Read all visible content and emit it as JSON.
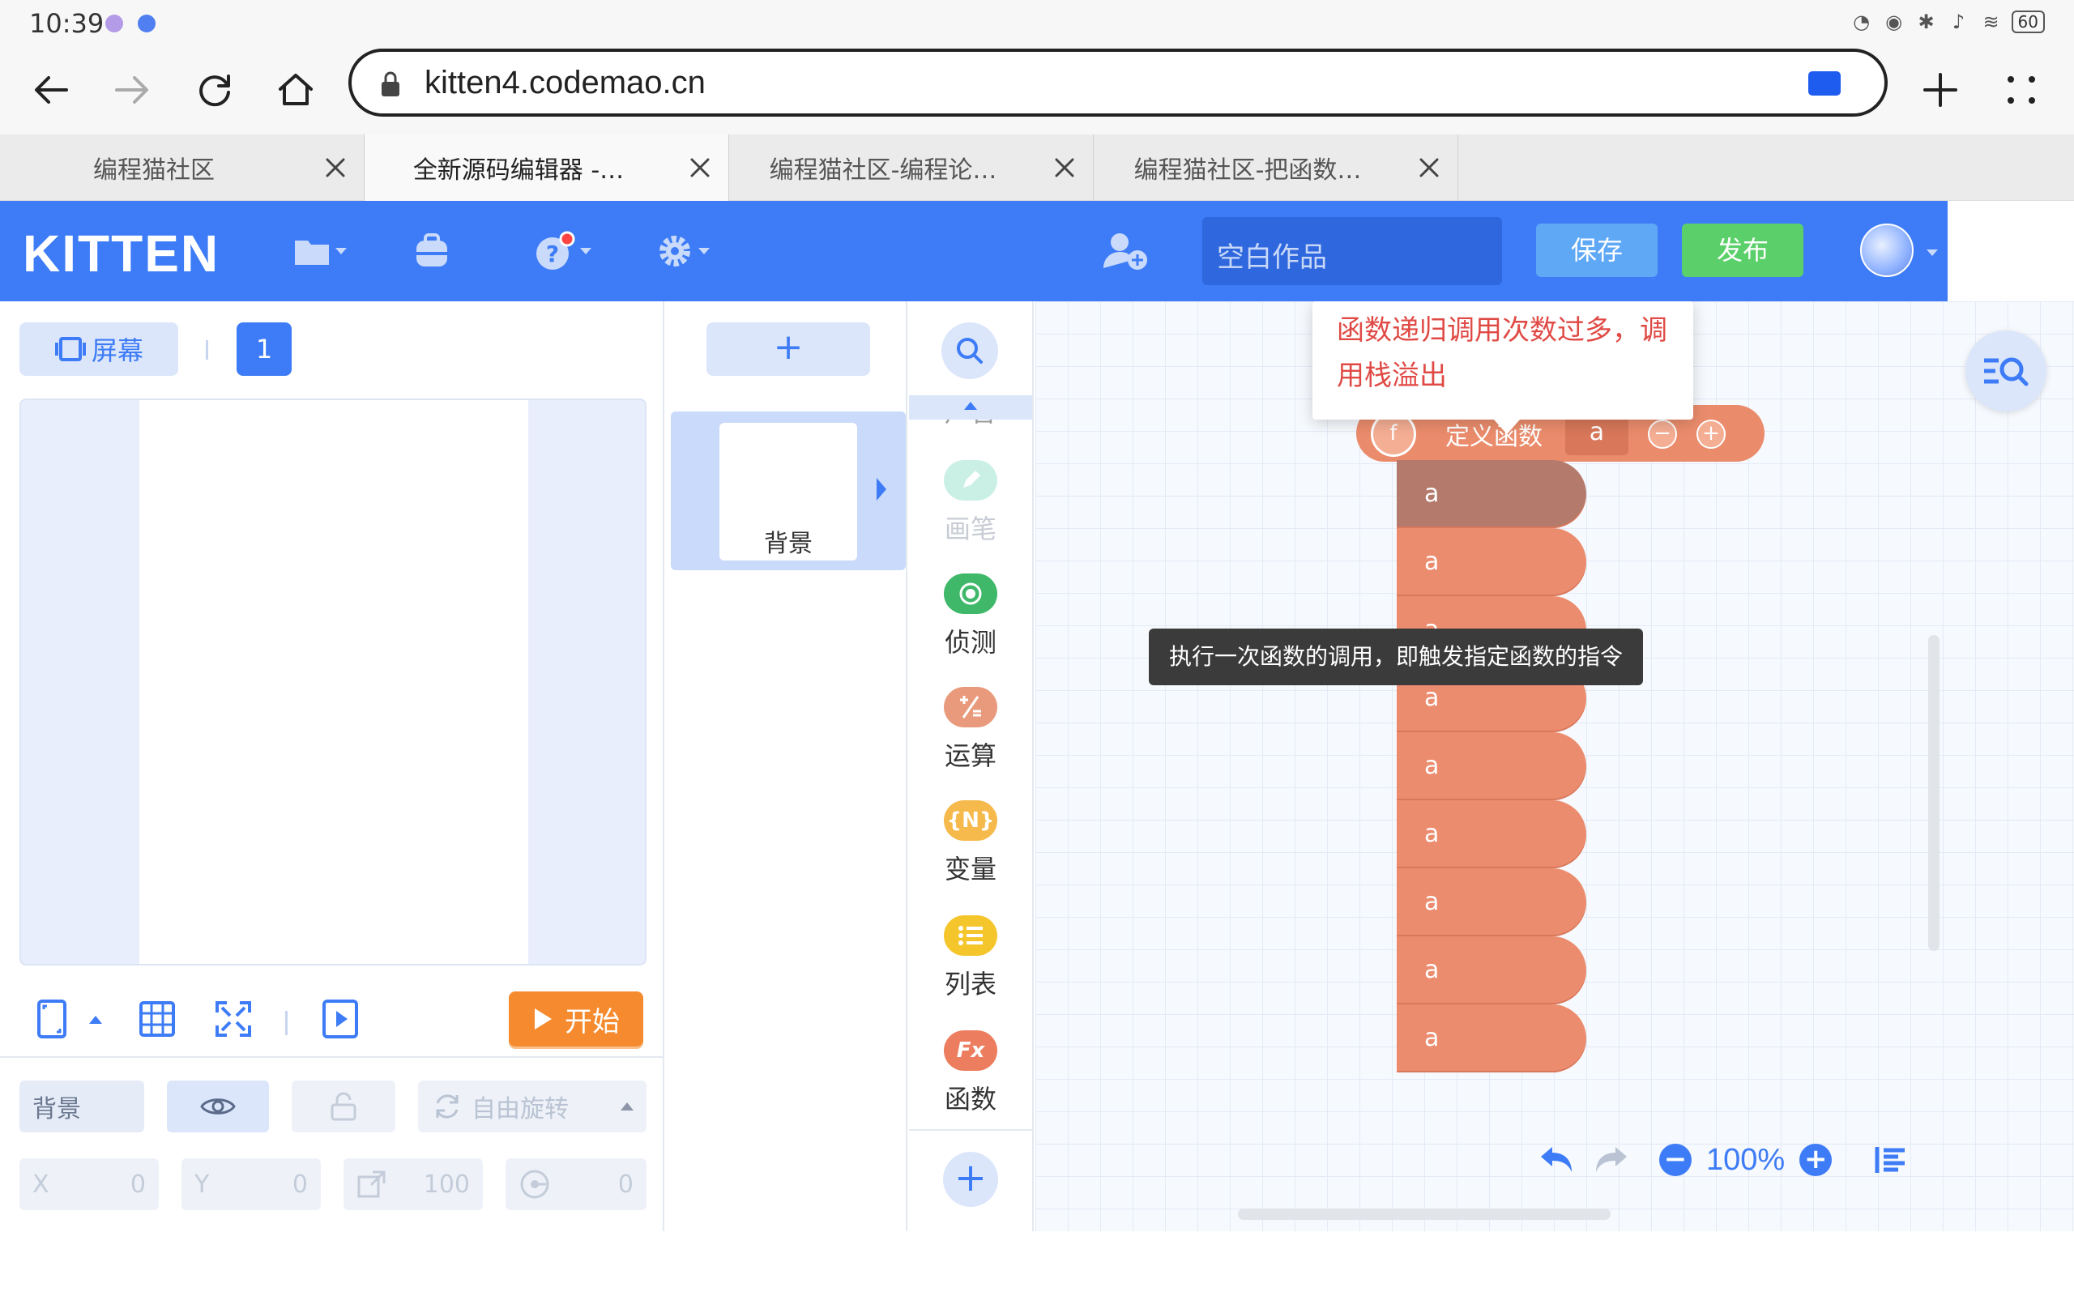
{
  "status_bar": {
    "time": "10:39",
    "battery": "60"
  },
  "browser": {
    "url": "kitten4.codemao.cn",
    "tabs": [
      {
        "title": "编程猫社区",
        "active": false
      },
      {
        "title": "全新源码编辑器 -…",
        "active": true
      },
      {
        "title": "编程猫社区-编程论…",
        "active": false
      },
      {
        "title": "编程猫社区-把函数…",
        "active": false
      }
    ]
  },
  "header": {
    "logo": "KITTEN",
    "work_name_placeholder": "空白作品",
    "save_label": "保存",
    "publish_label": "发布"
  },
  "stage": {
    "screen_label": "屏幕",
    "screen_number": "1",
    "start_label": "开始",
    "props": {
      "name": "背景",
      "rotation": "自由旋转",
      "x_label": "X",
      "x_value": "0",
      "y_label": "Y",
      "y_value": "0",
      "size_value": "100",
      "direction_value": "0"
    }
  },
  "sprites": {
    "add_label": "+",
    "items": [
      {
        "label": "背景"
      }
    ]
  },
  "categories": {
    "partial_top_label": "声音",
    "items": [
      {
        "label": "画笔",
        "icon": "pen-icon",
        "color": "#6ad6b8",
        "faded": true
      },
      {
        "label": "侦测",
        "icon": "detect-icon",
        "color": "#3fb86a",
        "faded": false
      },
      {
        "label": "运算",
        "icon": "math-icon",
        "color": "#e99a7c",
        "faded": false
      },
      {
        "label": "变量",
        "icon": "variable-icon",
        "color": "#f5b94c",
        "faded": false
      },
      {
        "label": "列表",
        "icon": "list-icon",
        "color": "#f5c62c",
        "faded": false
      },
      {
        "label": "函数",
        "icon": "function-icon",
        "color": "#ec7d5e",
        "faded": false
      }
    ],
    "var_glyph": "{N}",
    "fx_glyph": "Fx"
  },
  "workspace": {
    "define_block": {
      "label": "定义函数",
      "param": "a"
    },
    "call_blocks": [
      "a",
      "a",
      "a",
      "a",
      "a",
      "a",
      "a",
      "a",
      "a"
    ],
    "tooltip": "执行一次函数的调用，即触发指定函数的指令",
    "error_message": "函数递归调用次数过多，调用栈溢出",
    "zoom": "100%"
  },
  "colors": {
    "brand": "#3d7cf6",
    "function_block": "#ec8c6e",
    "start": "#f58a2e",
    "publish": "#5bd06a",
    "error": "#e04a45"
  }
}
